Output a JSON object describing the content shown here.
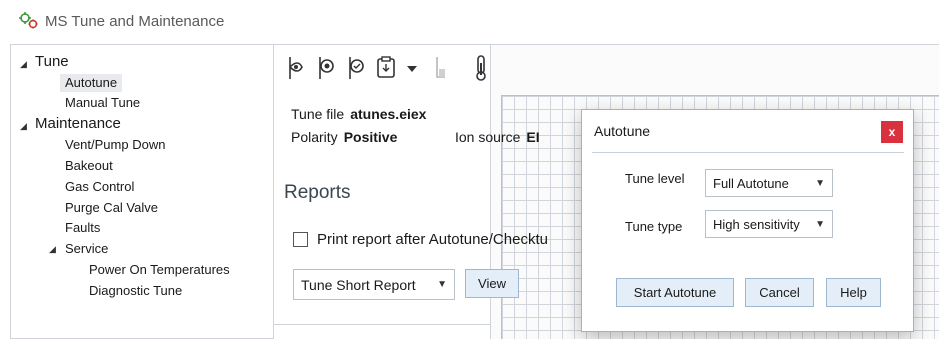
{
  "window": {
    "title": "MS Tune and Maintenance",
    "icon": "ms-tune-app-icon"
  },
  "tree": {
    "tune": {
      "label": "Tune",
      "expanded": true
    },
    "autotune": {
      "label": "Autotune",
      "selected": true
    },
    "manual_tune": {
      "label": "Manual Tune"
    },
    "maintenance": {
      "label": "Maintenance",
      "expanded": true
    },
    "vent_pump_down": {
      "label": "Vent/Pump Down"
    },
    "bakeout": {
      "label": "Bakeout"
    },
    "gas_control": {
      "label": "Gas Control"
    },
    "purge_cal_valve": {
      "label": "Purge Cal Valve"
    },
    "faults": {
      "label": "Faults"
    },
    "service": {
      "label": "Service",
      "expanded": true
    },
    "power_on_temperatures": {
      "label": "Power On Temperatures"
    },
    "diagnostic_tune": {
      "label": "Diagnostic Tune"
    }
  },
  "toolbar": {
    "icons": [
      "tune-probe-icon",
      "tune-target-icon",
      "tune-check-icon",
      "clipboard-dropdown-icon",
      "dropdown-arrow-icon",
      "column-disabled-icon",
      "thermometer-icon",
      "vial-icon",
      "probe-icon",
      "font-tune-icon",
      "download-icon",
      "upload-file-icon",
      "save-disabled-icon",
      "save-as-icon",
      "hand-disabled-icon"
    ]
  },
  "info": {
    "tune_file_label": "Tune file",
    "tune_file_value": "atunes.eiex",
    "polarity_label": "Polarity",
    "polarity_value": "Positive",
    "ion_source_label": "Ion source",
    "ion_source_value": "EI"
  },
  "reports": {
    "title": "Reports",
    "print_checkbox_label": "Print report after Autotune/Checktu",
    "print_checked": false,
    "report_select_value": "Tune Short Report",
    "view_button": "View"
  },
  "dialog": {
    "title": "Autotune",
    "close_label": "x",
    "tune_level_label": "Tune level",
    "tune_level_value": "Full Autotune",
    "tune_type_label": "Tune type",
    "tune_type_value": "High sensitivity",
    "start_button": "Start Autotune",
    "cancel_button": "Cancel",
    "help_button": "Help"
  },
  "colors": {
    "close_button": "#d9323e",
    "button_bg": "#e3eef8",
    "button_border": "#9fb8d0",
    "section_title": "#3a4750"
  }
}
